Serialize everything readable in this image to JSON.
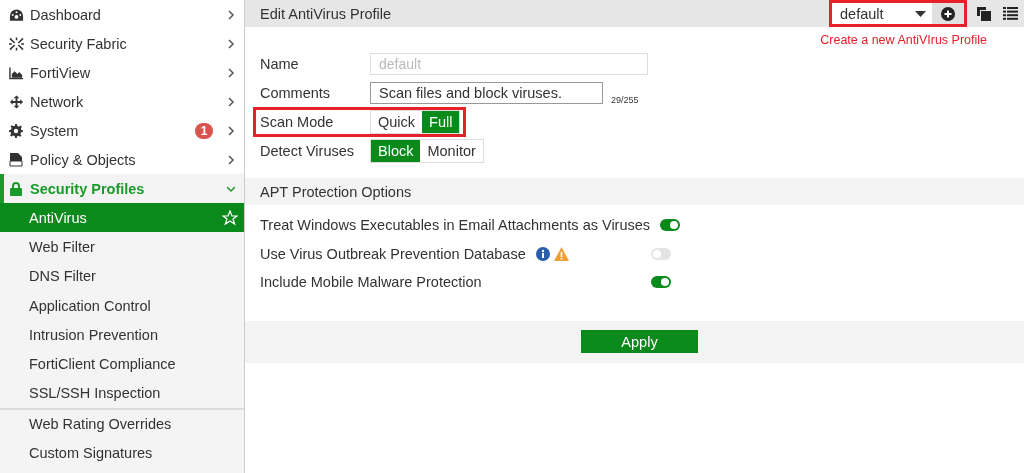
{
  "sidebar": {
    "items": [
      {
        "label": "Dashboard",
        "expanded": false
      },
      {
        "label": "Security Fabric",
        "expanded": false
      },
      {
        "label": "FortiView",
        "expanded": false
      },
      {
        "label": "Network",
        "expanded": false
      },
      {
        "label": "System",
        "expanded": false,
        "badge": "1"
      },
      {
        "label": "Policy & Objects",
        "expanded": false
      },
      {
        "label": "Security Profiles",
        "expanded": true,
        "children": [
          {
            "label": "AntiVirus",
            "selected": true,
            "separated": false
          },
          {
            "label": "Web Filter",
            "selected": false,
            "separated": false
          },
          {
            "label": "DNS Filter",
            "selected": false,
            "separated": false
          },
          {
            "label": "Application Control",
            "selected": false,
            "separated": false
          },
          {
            "label": "Intrusion Prevention",
            "selected": false,
            "separated": false
          },
          {
            "label": "FortiClient Compliance",
            "selected": false,
            "separated": false
          },
          {
            "label": "SSL/SSH Inspection",
            "selected": false,
            "separated": false
          },
          {
            "label": "Web Rating Overrides",
            "selected": false,
            "separated": true
          },
          {
            "label": "Custom Signatures",
            "selected": false,
            "separated": false
          }
        ]
      }
    ]
  },
  "header": {
    "title": "Edit AntiVirus Profile",
    "profile_select": {
      "value": "default",
      "highlighted": true
    },
    "annotation": "Create a new AntiVIrus Profile"
  },
  "form": {
    "name": {
      "label": "Name",
      "placeholder": "default"
    },
    "comments": {
      "label": "Comments",
      "value": "Scan files and block viruses.",
      "counter": "29/255"
    },
    "scan_mode": {
      "label": "Scan Mode",
      "highlighted": true,
      "options": [
        {
          "label": "Quick",
          "selected": false
        },
        {
          "label": "Full",
          "selected": true
        }
      ]
    },
    "detect_viruses": {
      "label": "Detect Viruses",
      "options": [
        {
          "label": "Block",
          "selected": true
        },
        {
          "label": "Monitor",
          "selected": false
        }
      ]
    }
  },
  "apt": {
    "title": "APT Protection Options",
    "options": [
      {
        "label": "Treat Windows Executables in Email Attachments as Viruses",
        "on": true,
        "kind": "plain"
      },
      {
        "label": "Use Virus Outbreak Prevention Database",
        "on": false,
        "kind": "alerted"
      },
      {
        "label": "Include Mobile Malware Protection",
        "on": true,
        "kind": "plain"
      }
    ]
  },
  "apply": {
    "label": "Apply"
  }
}
